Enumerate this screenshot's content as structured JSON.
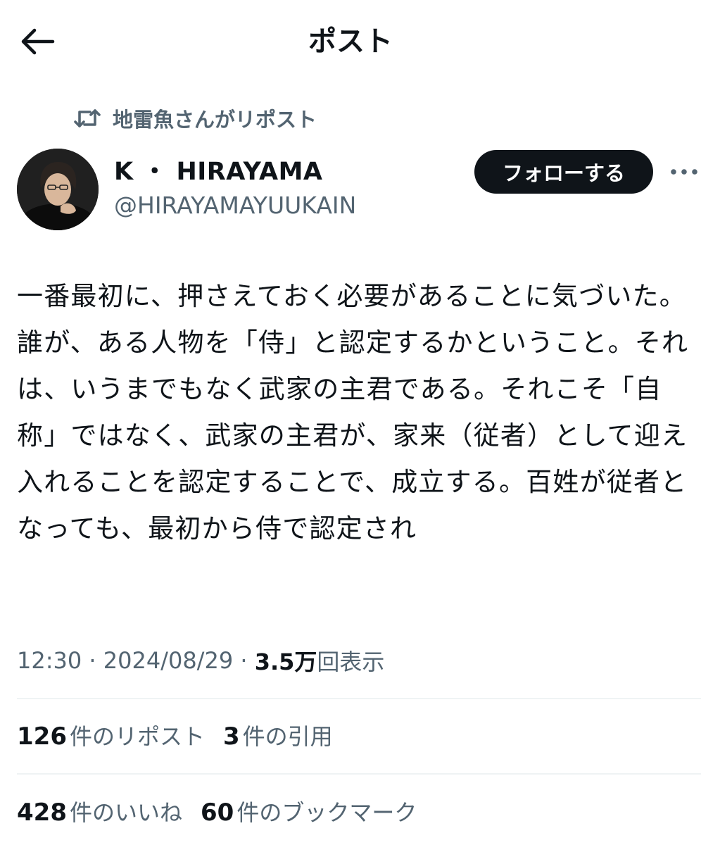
{
  "header": {
    "title": "ポスト",
    "back_icon": "arrow-left-icon"
  },
  "repost": {
    "label": "地雷魚さんがリポスト",
    "icon": "repost-icon"
  },
  "author": {
    "display_name": "K ・ HIRAYAMA",
    "handle": "@HIRAYAMAYUUKAIN"
  },
  "follow_label": "フォローする",
  "more_icon": "more-horizontal-icon",
  "post": {
    "text": "一番最初に、押さえておく必要があることに気づいた。誰が、ある人物を「侍」と認定するかということ。それは、いうまでもなく武家の主君である。それこそ「自称」ではなく、武家の主君が、家来（従者）として迎え入れることを認定することで、成立する。百姓が従者となっても、最初から侍で認定され"
  },
  "meta": {
    "time": "12:30",
    "sep1": " · ",
    "date": "2024/08/29",
    "sep2": " · ",
    "views": "3.5万",
    "views_label": "回表示"
  },
  "stats_row1": [
    {
      "count": "126",
      "label": "件のリポスト"
    },
    {
      "count": "3",
      "label": "件の引用"
    }
  ],
  "stats_row2": [
    {
      "count": "428",
      "label": "件のいいね"
    },
    {
      "count": "60",
      "label": "件のブックマーク"
    }
  ],
  "colors": {
    "text": "#0f1419",
    "secondary": "#536471",
    "divider": "#eff3f4",
    "button_bg": "#0f1419",
    "background": "#ffffff"
  }
}
